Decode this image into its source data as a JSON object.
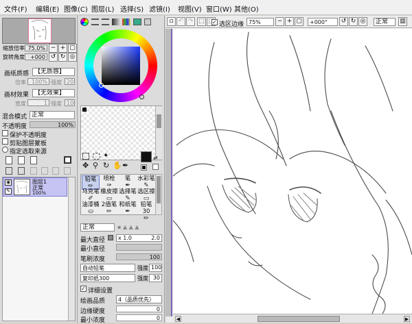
{
  "menu": {
    "items": [
      "文件(F)",
      "编辑(E)",
      "图像(C)",
      "图层(L)",
      "选择(S)",
      "滤镜(I)",
      "视图(V)",
      "窗口(W)",
      "其他(O)"
    ]
  },
  "nav": {
    "zoom_label": "缩放倍率",
    "zoom_value": "75.0%",
    "rotate_label": "旋转角度",
    "rotate_value": "+000"
  },
  "paper": {
    "texture_label": "画纸质感",
    "texture_value": "【无质感】",
    "scale_label": "倍率",
    "scale_value": "100%",
    "strength_label": "强度",
    "strength_value": "20",
    "effect_label": "画材效果",
    "effect_value": "【无效果】",
    "width_label": "宽度",
    "width_value": "1",
    "effect_strength_label": "强度",
    "effect_strength_value": "100"
  },
  "blend": {
    "mode_label": "混合模式",
    "mode_value": "正常",
    "opacity_label": "不透明度",
    "opacity_value": "100%",
    "opt1": "保护不透明度",
    "opt2": "剪贴图层蒙板",
    "opt3": "指定选取来源"
  },
  "layer": {
    "name": "图层1",
    "mode": "正常",
    "opacity": "100%"
  },
  "tools": {
    "labels": [
      "铅笔",
      "喷枪",
      "笔",
      "水彩笔",
      "马克笔",
      "橡皮擦",
      "选择笔",
      "选区擦",
      "油漆桶",
      "2值笔",
      "和纸笔",
      "铅笔30"
    ]
  },
  "brush": {
    "mode_value": "正常",
    "max_size_label": "最大直径",
    "max_size_mult": "x 1.0",
    "max_size_value": "2.0",
    "min_size_label": "最小直径",
    "density_label": "笔刷浓度",
    "density_value": "100",
    "shape1": "自动铅笔",
    "shape1_strength_label": "强度",
    "shape1_strength": "100",
    "shape2": "复印纸300",
    "shape2_strength_label": "强度",
    "shape2_strength": "30",
    "detail_label": "详细设置",
    "quality_label": "绘画品质",
    "quality_value": "4（品质优先）",
    "edge_label": "边缘硬度",
    "edge_value": "0",
    "min_density_label": "最小浓度",
    "min_density_value": "0"
  },
  "canvas_toolbar": {
    "selection_edge": "选区边缘",
    "zoom": "75%",
    "angle": "+000°",
    "mode": "正常"
  }
}
